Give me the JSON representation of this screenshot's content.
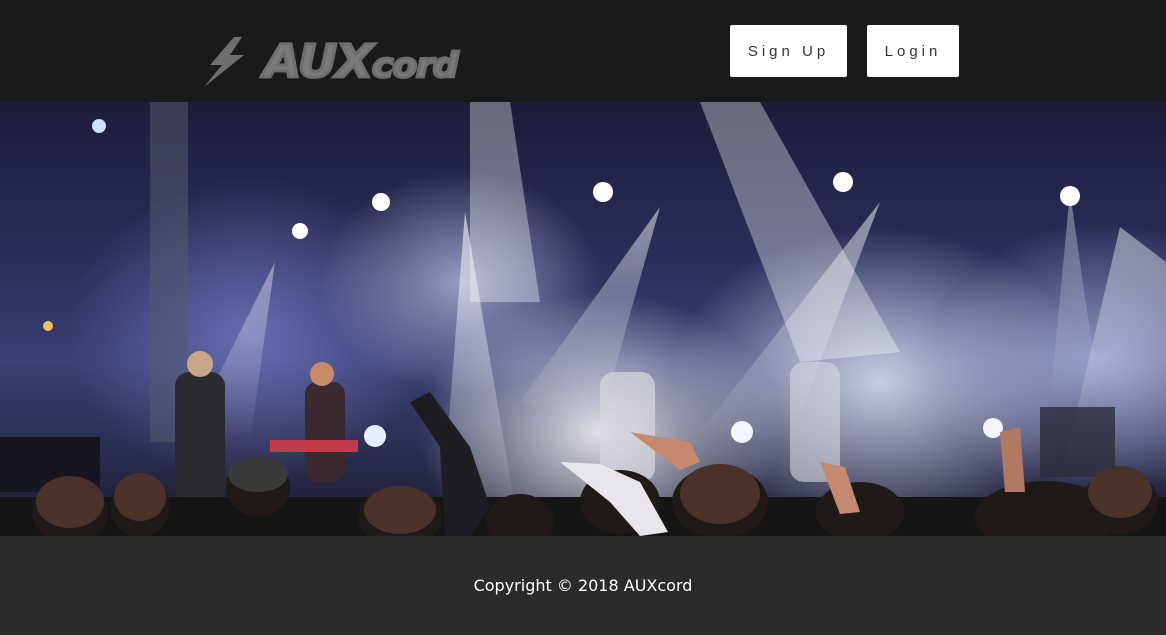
{
  "header": {
    "logo_icon": "lightning-bolt-icon",
    "logo_text_main": "AUX",
    "logo_text_rest": "cord",
    "signup_label": "Sign Up",
    "login_label": "Login"
  },
  "hero": {
    "image": "concert-crowd-stage-lights"
  },
  "footer": {
    "copyright": "Copyright © 2018 AUXcord"
  },
  "colors": {
    "header_bg": "#1a1a1a",
    "footer_bg": "#2b2b2b",
    "logo_gray": "#7a7a7a",
    "button_bg": "#ffffff"
  }
}
